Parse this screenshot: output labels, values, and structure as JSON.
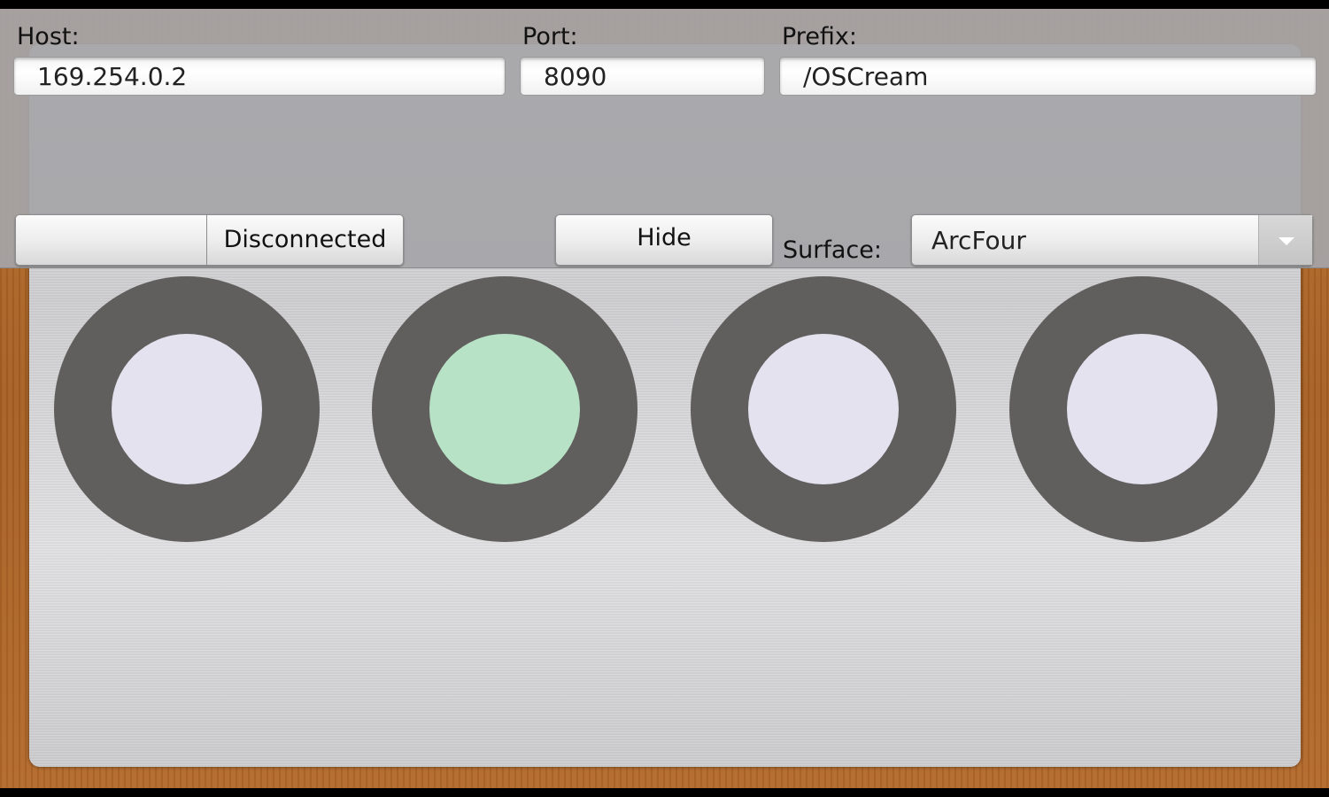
{
  "connection": {
    "host_label": "Host:",
    "host_value": "169.254.0.2",
    "port_label": "Port:",
    "port_value": "8090",
    "prefix_label": "Prefix:",
    "prefix_value": "/OSCream"
  },
  "controls": {
    "status_label": "Disconnected",
    "hide_label": "Hide",
    "surface_label": "Surface:",
    "surface_value": "ArcFour"
  },
  "knobs": [
    {
      "active": false,
      "color": "#e3e2ee"
    },
    {
      "active": true,
      "color": "#b8e2c6"
    },
    {
      "active": false,
      "color": "#e3e2ee"
    },
    {
      "active": false,
      "color": "#e3e2ee"
    }
  ],
  "colors": {
    "ring": "#605f5d",
    "wood": "#b06628",
    "overlay": "#a5a5a8"
  }
}
